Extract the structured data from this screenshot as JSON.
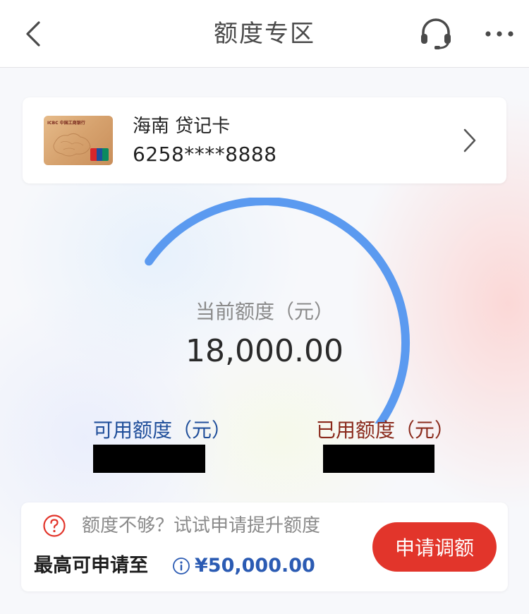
{
  "header": {
    "title": "额度专区",
    "back_icon": "chevron-left-icon",
    "service_icon": "headset-icon",
    "more_icon": "more-dots-icon"
  },
  "card": {
    "name": "海南 贷记卡",
    "number": "6258****8888",
    "thumbnail_brand": "ICBC 中国工商银行",
    "chevron_icon": "chevron-right-icon"
  },
  "limit": {
    "current_label": "当前额度（元）",
    "current_value": "18,000.00",
    "available_label": "可用额度（元）",
    "used_label": "已用额度（元）",
    "available_value_redacted": true,
    "used_value_redacted": true,
    "used_fraction": 0.2
  },
  "promo": {
    "hint": "额度不够？试试申请提升额度",
    "max_label": "最高可申请至",
    "max_value": "¥50,000.00",
    "apply_button": "申请调额",
    "question_icon": "question-circle-icon",
    "info_icon": "info-icon"
  },
  "colors": {
    "available_arc": "#5b9af0",
    "used_arc": "#f06a35",
    "apply_button": "#e2352b",
    "available_text": "#1f4e9a",
    "used_text": "#8a2a1c",
    "max_value_text": "#2b5bb3"
  }
}
